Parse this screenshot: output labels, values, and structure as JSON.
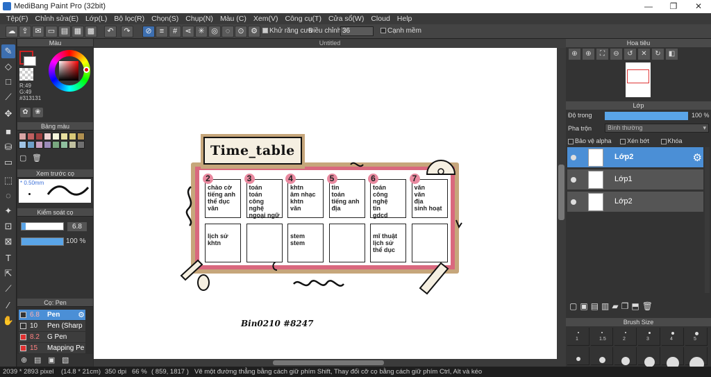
{
  "window": {
    "title": "MediBang Paint Pro (32bit)",
    "minimize": "—",
    "restore": "❐",
    "close": "✕"
  },
  "menu": [
    "Tệp(F)",
    "Chỉnh sửa(E)",
    "Lớp(L)",
    "Bộ lọc(R)",
    "Chọn(S)",
    "Chụp(N)",
    "Màu (C)",
    "Xem(V)",
    "Công cụ(T)",
    "Cửa sổ(W)",
    "Cloud",
    "Help"
  ],
  "toolbar": {
    "antialias_label": "Khử răng cưa",
    "adjust_label": "Điều chỉnh",
    "adjust_value": "36",
    "smooth_label": "Cạnh mềm"
  },
  "color_panel": {
    "title": "Màu",
    "r": "R:49",
    "g": "G:49",
    "b": "B:49",
    "hex": "#313131",
    "primary": "#313131",
    "ring_primary": "#cc2222"
  },
  "palette_panel": {
    "title": "Bảng màu",
    "swatches": [
      "#d9a5a5",
      "#c06060",
      "#a04040",
      "#f0d0d0",
      "#f5f5dc",
      "#e8e0a0",
      "#d8c878",
      "#b09050",
      "#a0c4e4",
      "#6fa0c8",
      "#c8a0c0",
      "#9a8ab8",
      "#7aa880",
      "#8fbf9f",
      "#c0c0a0",
      "#707070"
    ]
  },
  "brush_preview": {
    "title": "Xem trước cọ",
    "size": "0.50mm"
  },
  "brush_control": {
    "title": "Kiểm soát cọ",
    "size_value": "6.8",
    "opacity_value": "100 %"
  },
  "brush_list": {
    "title": "Cọ: Pen",
    "items": [
      {
        "size": "6.8",
        "name": "Pen",
        "color": "#333333",
        "selected": true
      },
      {
        "size": "10",
        "name": "Pen (Sharp",
        "color": "#333333",
        "selected": false
      },
      {
        "size": "8.2",
        "name": "G Pen",
        "color": "#e03030",
        "selected": false
      },
      {
        "size": "15",
        "name": "Mapping Pe",
        "color": "#e03030",
        "selected": false
      }
    ]
  },
  "canvas": {
    "doc_title": "Untitled"
  },
  "artwork": {
    "heading": "Time_table",
    "signature": "Bin0210 #8247",
    "days": [
      {
        "num": "2",
        "morning": "chào cờ\ntiếng anh\nthể dục\nvăn",
        "afternoon": "lịch sử\nkhtn"
      },
      {
        "num": "3",
        "morning": "toán\ntoán\ncông nghệ\nngoại ngữ",
        "afternoon": ""
      },
      {
        "num": "4",
        "morning": "khtn\nâm nhạc\nkhtn\nvăn",
        "afternoon": "stem\nstem"
      },
      {
        "num": "5",
        "morning": "tin\ntoán\ntiếng anh\nđịa",
        "afternoon": ""
      },
      {
        "num": "6",
        "morning": "toán\ncông nghệ\ntin\ngdcd",
        "afternoon": "mĩ thuật\nlịch sử\nthể dục"
      },
      {
        "num": "7",
        "morning": "văn\nvăn\nđịa\nsinh hoạt",
        "afternoon": ""
      }
    ]
  },
  "navigator": {
    "title": "Hoa tiêu"
  },
  "layers_panel": {
    "title": "Lớp",
    "opacity_label": "Độ trong",
    "opacity_value": "100 %",
    "blend_label": "Pha trộn",
    "blend_value": "Bình thường",
    "protect_alpha": "Bảo vệ alpha",
    "clip": "Xén bớt",
    "lock": "Khóa",
    "layers": [
      {
        "name": "Lớp2",
        "selected": true
      },
      {
        "name": "Lớp1",
        "selected": false
      },
      {
        "name": "Lớp2",
        "selected": false
      }
    ]
  },
  "brush_size_panel": {
    "title": "Brush Size",
    "sizes": [
      "1",
      "1.5",
      "2",
      "3",
      "4",
      "5"
    ]
  },
  "status": {
    "size": "2039 * 2893 pixel",
    "paper": "(14.8 * 21cm)",
    "dpi": "350 dpi",
    "zoom": "66 %",
    "coords": "( 859, 1817 )",
    "hint": "Vẽ một đường thẳng bằng cách giữ phím Shift, Thay đổi cỡ cọ bằng cách giữ phím Ctrl, Alt và kéo"
  }
}
